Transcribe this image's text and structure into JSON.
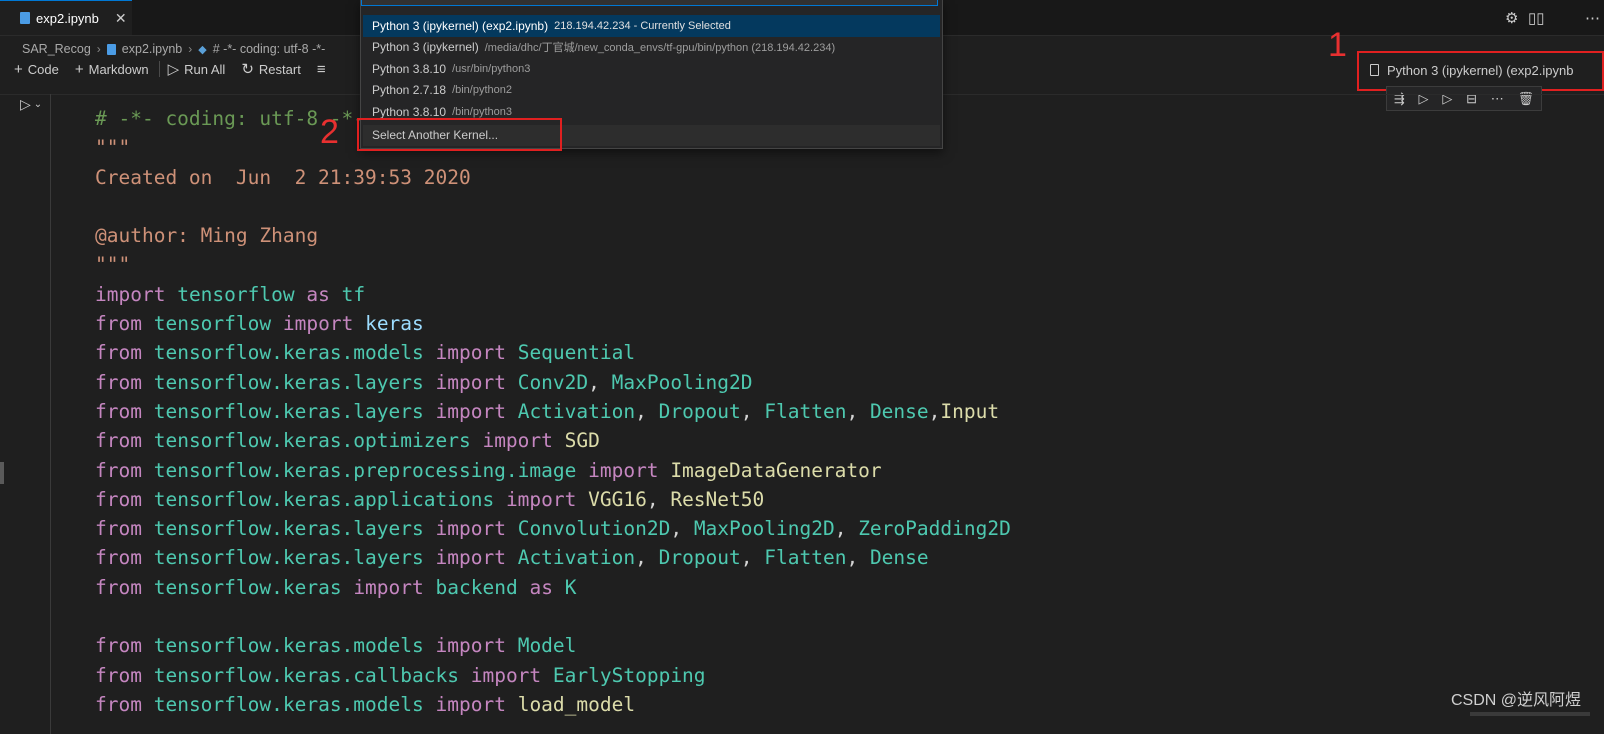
{
  "tab": {
    "label": "exp2.ipynb",
    "close": "✕"
  },
  "topright": {
    "gear": "⚙",
    "more": "⋯"
  },
  "breadcrumb": {
    "items": [
      "SAR_Recog",
      "exp2.ipynb",
      "# -*- coding: utf-8 -*-"
    ],
    "separator": "›"
  },
  "toolbar": {
    "code_label": "Code",
    "markdown_label": "Markdown",
    "run_all_label": "Run All",
    "restart_label": "Restart"
  },
  "kernel": {
    "label": "Python 3 (ipykernel) (exp2.ipynb"
  },
  "annotations": {
    "one": "1",
    "two": "2"
  },
  "picker": {
    "items": [
      {
        "label": "Python 3 (ipykernel) (exp2.ipynb)",
        "desc": "218.194.42.234 - Currently Selected"
      },
      {
        "label": "Python 3 (ipykernel)",
        "desc": "/media/dhc/丁官城/new_conda_envs/tf-gpu/bin/python (218.194.42.234)"
      },
      {
        "label": "Python 3.8.10",
        "desc": "/usr/bin/python3"
      },
      {
        "label": "Python 2.7.18",
        "desc": "/bin/python2"
      },
      {
        "label": "Python 3.8.10",
        "desc": "/bin/python3"
      },
      {
        "label": "Select Another Kernel...",
        "desc": ""
      }
    ]
  },
  "code_lines": [
    [
      [
        "cmt",
        "# -*- coding: utf-8 -*-"
      ]
    ],
    [
      [
        "str",
        "\"\"\""
      ]
    ],
    [
      [
        "str",
        "Created on  Jun  2 21:39:53 2020"
      ]
    ],
    [
      [
        "str",
        ""
      ]
    ],
    [
      [
        "str",
        "@author: Ming Zhang"
      ]
    ],
    [
      [
        "str",
        "\"\"\""
      ]
    ],
    [
      [
        "kw",
        "import"
      ],
      [
        "",
        " "
      ],
      [
        "mod",
        "tensorflow"
      ],
      [
        "",
        " "
      ],
      [
        "kw",
        "as"
      ],
      [
        "",
        " "
      ],
      [
        "mod",
        "tf"
      ]
    ],
    [
      [
        "kw",
        "from"
      ],
      [
        "",
        " "
      ],
      [
        "mod",
        "tensorflow"
      ],
      [
        "",
        " "
      ],
      [
        "kw",
        "import"
      ],
      [
        "",
        " "
      ],
      [
        "var",
        "keras"
      ]
    ],
    [
      [
        "kw",
        "from"
      ],
      [
        "",
        " "
      ],
      [
        "mod",
        "tensorflow.keras.models"
      ],
      [
        "",
        " "
      ],
      [
        "kw",
        "import"
      ],
      [
        "",
        " "
      ],
      [
        "cls",
        "Sequential"
      ]
    ],
    [
      [
        "kw",
        "from"
      ],
      [
        "",
        " "
      ],
      [
        "mod",
        "tensorflow.keras.layers"
      ],
      [
        "",
        " "
      ],
      [
        "kw",
        "import"
      ],
      [
        "",
        " "
      ],
      [
        "cls",
        "Conv2D"
      ],
      [
        "",
        ", "
      ],
      [
        "cls",
        "MaxPooling2D"
      ]
    ],
    [
      [
        "kw",
        "from"
      ],
      [
        "",
        " "
      ],
      [
        "mod",
        "tensorflow.keras.layers"
      ],
      [
        "",
        " "
      ],
      [
        "kw",
        "import"
      ],
      [
        "",
        " "
      ],
      [
        "cls",
        "Activation"
      ],
      [
        "",
        ", "
      ],
      [
        "cls",
        "Dropout"
      ],
      [
        "",
        ", "
      ],
      [
        "cls",
        "Flatten"
      ],
      [
        "",
        ", "
      ],
      [
        "cls",
        "Dense"
      ],
      [
        "",
        ","
      ],
      [
        "fn",
        "Input"
      ]
    ],
    [
      [
        "kw",
        "from"
      ],
      [
        "",
        " "
      ],
      [
        "mod",
        "tensorflow.keras.optimizers"
      ],
      [
        "",
        " "
      ],
      [
        "kw",
        "import"
      ],
      [
        "",
        " "
      ],
      [
        "fn",
        "SGD"
      ]
    ],
    [
      [
        "kw",
        "from"
      ],
      [
        "",
        " "
      ],
      [
        "mod",
        "tensorflow.keras.preprocessing.image"
      ],
      [
        "",
        " "
      ],
      [
        "kw",
        "import"
      ],
      [
        "",
        " "
      ],
      [
        "fn",
        "ImageDataGenerator"
      ]
    ],
    [
      [
        "kw",
        "from"
      ],
      [
        "",
        " "
      ],
      [
        "mod",
        "tensorflow.keras.applications"
      ],
      [
        "",
        " "
      ],
      [
        "kw",
        "import"
      ],
      [
        "",
        " "
      ],
      [
        "fn",
        "VGG16"
      ],
      [
        "",
        ", "
      ],
      [
        "fn",
        "ResNet50"
      ]
    ],
    [
      [
        "kw",
        "from"
      ],
      [
        "",
        " "
      ],
      [
        "mod",
        "tensorflow.keras.layers"
      ],
      [
        "",
        " "
      ],
      [
        "kw",
        "import"
      ],
      [
        "",
        " "
      ],
      [
        "cls",
        "Convolution2D"
      ],
      [
        "",
        ", "
      ],
      [
        "cls",
        "MaxPooling2D"
      ],
      [
        "",
        ", "
      ],
      [
        "cls",
        "ZeroPadding2D"
      ]
    ],
    [
      [
        "kw",
        "from"
      ],
      [
        "",
        " "
      ],
      [
        "mod",
        "tensorflow.keras.layers"
      ],
      [
        "",
        " "
      ],
      [
        "kw",
        "import"
      ],
      [
        "",
        " "
      ],
      [
        "cls",
        "Activation"
      ],
      [
        "",
        ", "
      ],
      [
        "cls",
        "Dropout"
      ],
      [
        "",
        ", "
      ],
      [
        "cls",
        "Flatten"
      ],
      [
        "",
        ", "
      ],
      [
        "cls",
        "Dense"
      ]
    ],
    [
      [
        "kw",
        "from"
      ],
      [
        "",
        " "
      ],
      [
        "mod",
        "tensorflow.keras"
      ],
      [
        "",
        " "
      ],
      [
        "kw",
        "import"
      ],
      [
        "",
        " "
      ],
      [
        "mod",
        "backend"
      ],
      [
        "",
        " "
      ],
      [
        "kw",
        "as"
      ],
      [
        "",
        " "
      ],
      [
        "mod",
        "K"
      ]
    ],
    [
      [
        "",
        ""
      ]
    ],
    [
      [
        "kw",
        "from"
      ],
      [
        "",
        " "
      ],
      [
        "mod",
        "tensorflow.keras.models"
      ],
      [
        "",
        " "
      ],
      [
        "kw",
        "import"
      ],
      [
        "",
        " "
      ],
      [
        "cls",
        "Model"
      ]
    ],
    [
      [
        "kw",
        "from"
      ],
      [
        "",
        " "
      ],
      [
        "mod",
        "tensorflow.keras.callbacks"
      ],
      [
        "",
        " "
      ],
      [
        "kw",
        "import"
      ],
      [
        "",
        " "
      ],
      [
        "cls",
        "EarlyStopping"
      ]
    ],
    [
      [
        "kw",
        "from"
      ],
      [
        "",
        " "
      ],
      [
        "mod",
        "tensorflow.keras.models"
      ],
      [
        "",
        " "
      ],
      [
        "kw",
        "import"
      ],
      [
        "",
        " "
      ],
      [
        "fn",
        "load_model"
      ]
    ]
  ],
  "watermark": "CSDN @逆风阿煜"
}
